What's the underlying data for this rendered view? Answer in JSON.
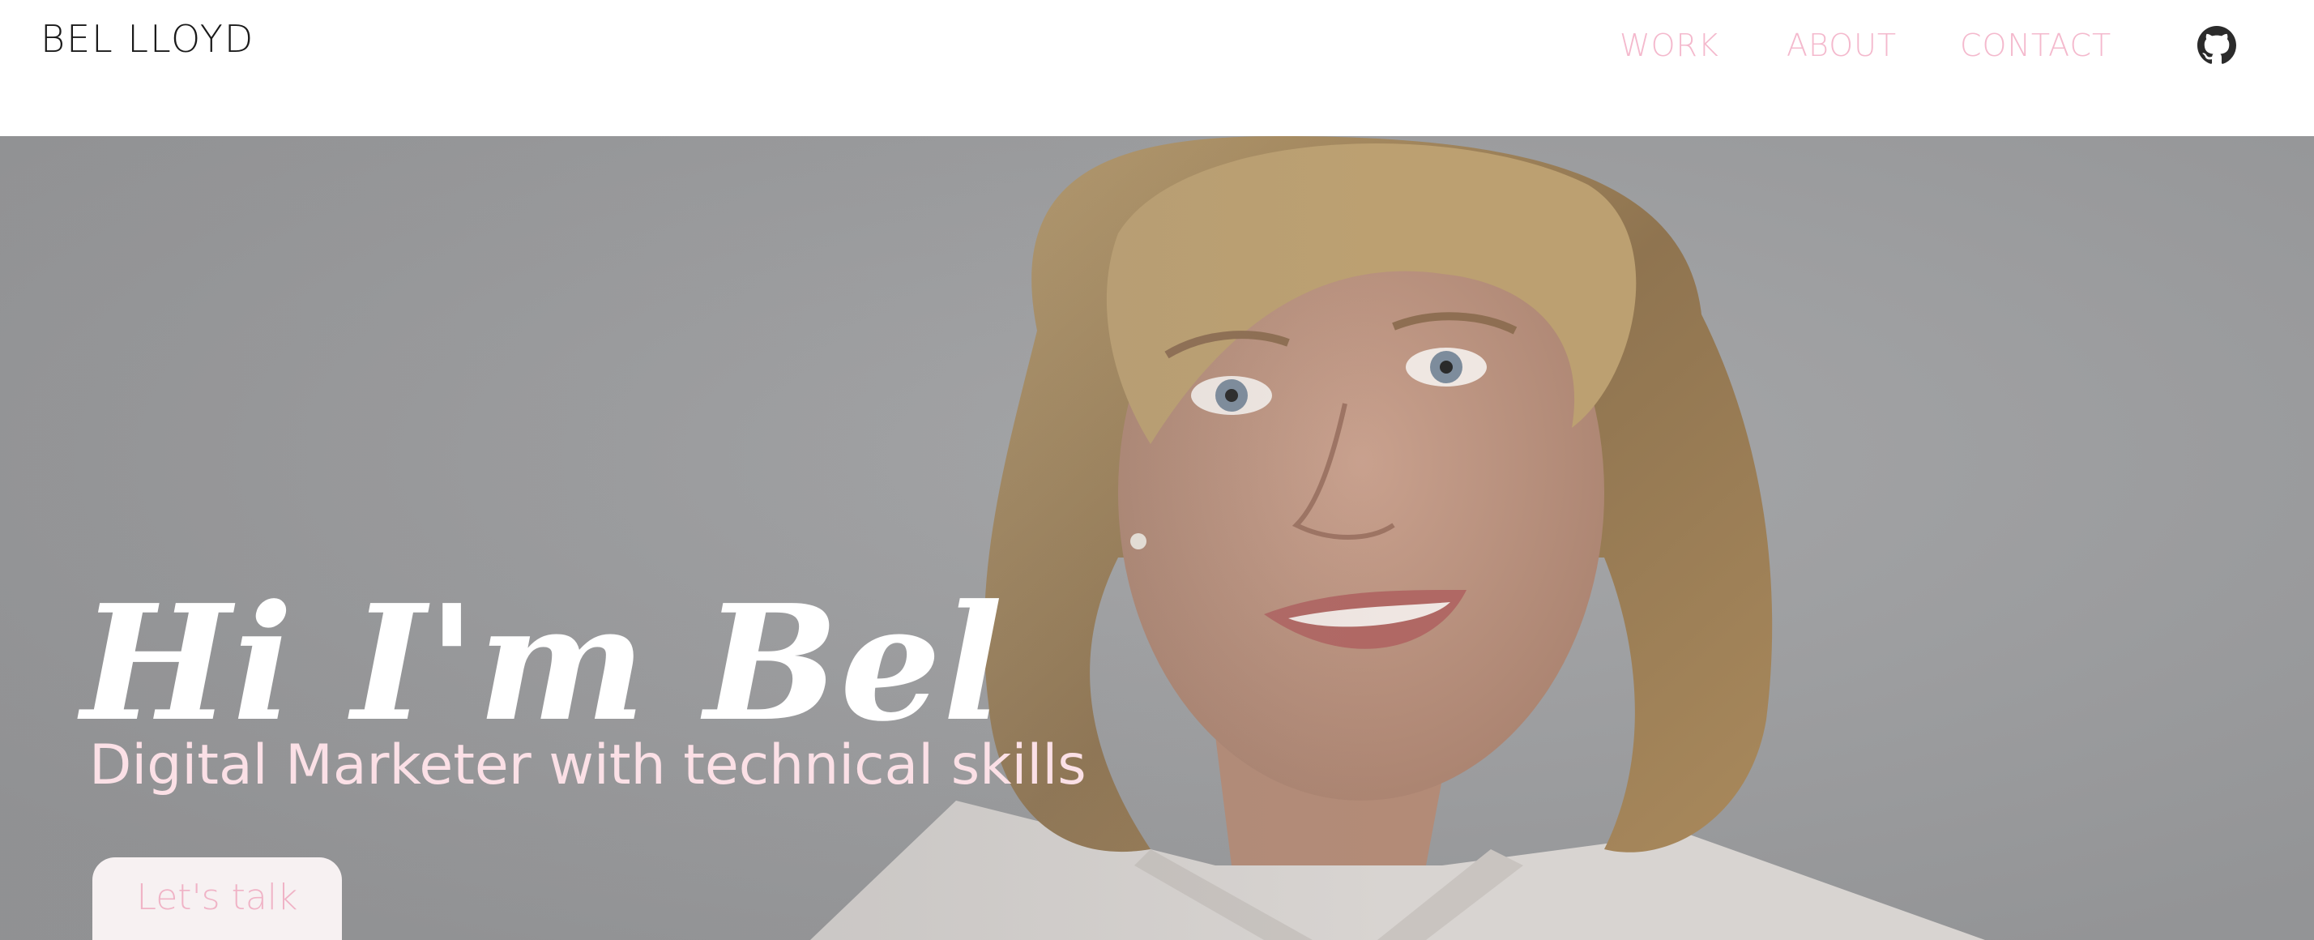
{
  "header": {
    "brand": "BEL LLOYD",
    "nav": [
      {
        "label": "WORK"
      },
      {
        "label": "ABOUT"
      },
      {
        "label": "CONTACT"
      }
    ],
    "github_icon": "github-icon"
  },
  "hero": {
    "title": "Hi I'm Bel",
    "subtitle": "Digital Marketer with technical skills",
    "cta_label": "Let's talk"
  },
  "colors": {
    "nav_link": "#f4b9cd",
    "hero_background": "#9a9b9d",
    "subtitle": "#fbe0e6",
    "cta_background": "#f7f1f2",
    "cta_text": "#f0b3c6"
  }
}
